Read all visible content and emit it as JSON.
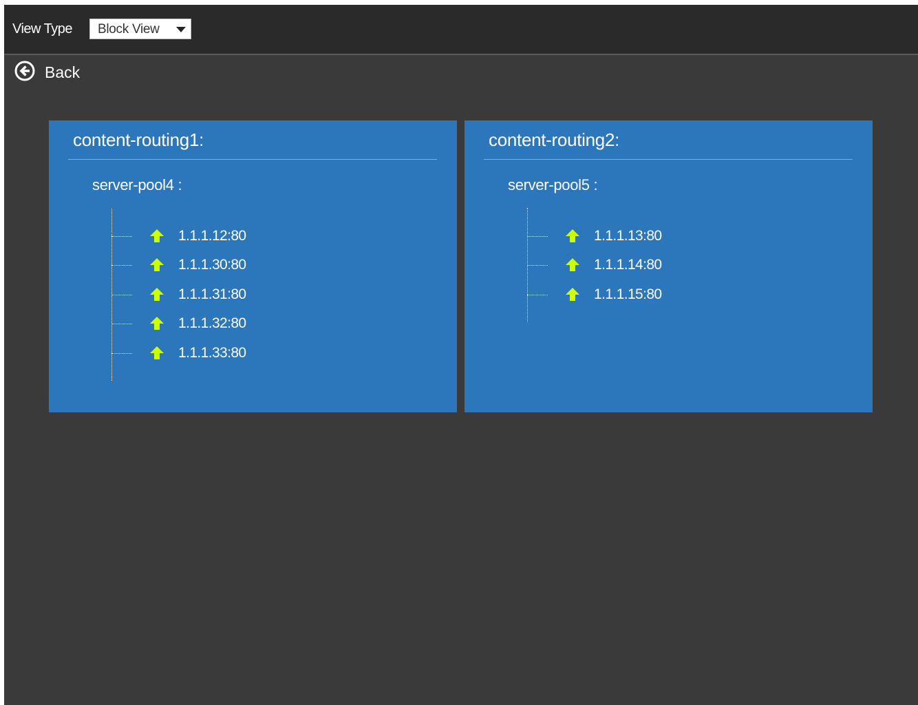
{
  "toolbar": {
    "view_type_label": "View Type",
    "view_select": {
      "selected": "Block View"
    }
  },
  "back": {
    "label": "Back"
  },
  "colors": {
    "toolbar_bg": "#2a2a2a",
    "page_bg": "#3a3a3a",
    "panel_bg": "#2c76bc",
    "status_up": "#ccff00"
  },
  "content_routings": [
    {
      "title": "content-routing1:",
      "pool": "server-pool4 :",
      "servers": [
        {
          "address": "1.1.1.12:80",
          "status_icon": "up-arrow-icon"
        },
        {
          "address": "1.1.1.30:80",
          "status_icon": "up-arrow-icon"
        },
        {
          "address": "1.1.1.31:80",
          "status_icon": "up-arrow-icon"
        },
        {
          "address": "1.1.1.32:80",
          "status_icon": "up-arrow-icon"
        },
        {
          "address": "1.1.1.33:80",
          "status_icon": "up-arrow-icon"
        }
      ]
    },
    {
      "title": "content-routing2:",
      "pool": "server-pool5 :",
      "servers": [
        {
          "address": "1.1.1.13:80",
          "status_icon": "up-arrow-icon"
        },
        {
          "address": "1.1.1.14:80",
          "status_icon": "up-arrow-icon"
        },
        {
          "address": "1.1.1.15:80",
          "status_icon": "up-arrow-icon"
        }
      ]
    }
  ]
}
